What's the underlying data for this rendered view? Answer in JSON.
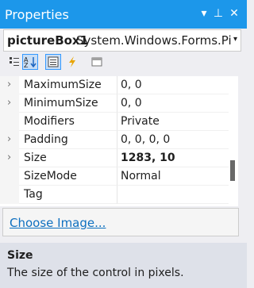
{
  "window": {
    "title": "Properties",
    "buttons": [
      "▾",
      "⊥",
      "✕"
    ]
  },
  "object_selector": {
    "name": "pictureBox1",
    "type": "System.Windows.Forms.Pictu",
    "dropdown": "▾"
  },
  "toolbar": {
    "icons": [
      "categorized-icon",
      "alphabetical-icon",
      "properties-icon",
      "events-icon",
      "property-pages-icon"
    ]
  },
  "properties": [
    {
      "name": "MaximumSize",
      "value": "0, 0",
      "expandable": true,
      "bold": false
    },
    {
      "name": "MinimumSize",
      "value": "0, 0",
      "expandable": true,
      "bold": false
    },
    {
      "name": "Modifiers",
      "value": "Private",
      "expandable": false,
      "bold": false
    },
    {
      "name": "Padding",
      "value": "0, 0, 0, 0",
      "expandable": true,
      "bold": false
    },
    {
      "name": "Size",
      "value": "1283, 10",
      "expandable": true,
      "bold": true
    },
    {
      "name": "SizeMode",
      "value": "Normal",
      "expandable": false,
      "bold": false
    },
    {
      "name": "Tag",
      "value": "",
      "expandable": false,
      "bold": false
    }
  ],
  "commands": {
    "link": "Choose Image..."
  },
  "description": {
    "title": "Size",
    "text": "The size of the control in pixels."
  },
  "colors": {
    "titlebar": "#1c97ea",
    "link": "#0e70c0"
  }
}
